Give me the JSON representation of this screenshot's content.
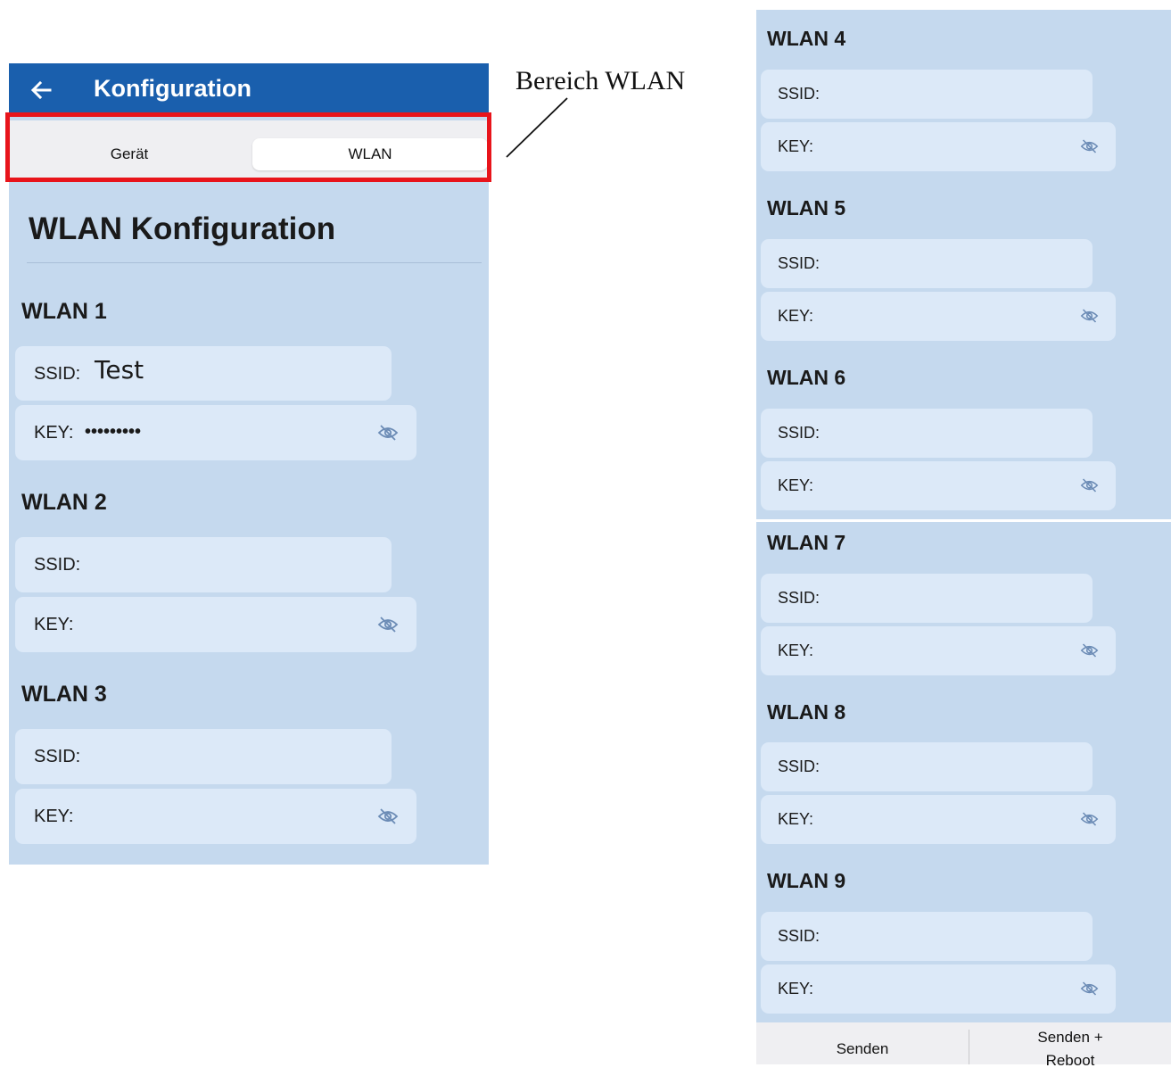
{
  "appbar": {
    "title": "Konfiguration"
  },
  "tabs": {
    "geraet": "Gerät",
    "wlan": "WLAN"
  },
  "page": {
    "heading": "WLAN Konfiguration"
  },
  "annotation": {
    "text": "Bereich WLAN"
  },
  "labels": {
    "ssid": "SSID:",
    "key": "KEY:"
  },
  "networks": [
    {
      "title": "WLAN 1",
      "ssid": "Test",
      "key_masked": "•••••••••"
    },
    {
      "title": "WLAN 2",
      "ssid": "",
      "key_masked": ""
    },
    {
      "title": "WLAN 3",
      "ssid": "",
      "key_masked": ""
    },
    {
      "title": "WLAN 4",
      "ssid": "",
      "key_masked": ""
    },
    {
      "title": "WLAN 5",
      "ssid": "",
      "key_masked": ""
    },
    {
      "title": "WLAN 6",
      "ssid": "",
      "key_masked": ""
    },
    {
      "title": "WLAN 7",
      "ssid": "",
      "key_masked": ""
    },
    {
      "title": "WLAN 8",
      "ssid": "",
      "key_masked": ""
    },
    {
      "title": "WLAN 9",
      "ssid": "",
      "key_masked": ""
    }
  ],
  "buttons": {
    "senden": "Senden",
    "senden_reboot_line1": "Senden +",
    "senden_reboot_line2": "Reboot"
  },
  "icons": {
    "back": "arrow-left-icon",
    "eye": "eye-off-icon"
  },
  "colors": {
    "appbar": "#1a5fad",
    "background": "#c5d9ee",
    "field": "#dce9f8",
    "highlight": "#e8141b"
  }
}
